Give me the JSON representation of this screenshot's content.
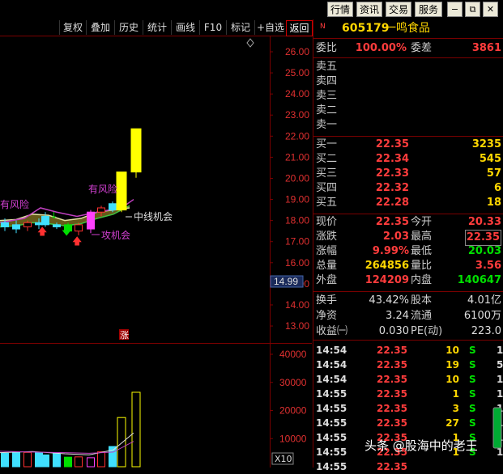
{
  "top_menu": [
    {
      "label": "行情"
    },
    {
      "label": "资讯"
    },
    {
      "label": "交易"
    },
    {
      "label": "服务"
    }
  ],
  "toolbar": [
    {
      "label": "复权"
    },
    {
      "label": "叠加"
    },
    {
      "label": "历史"
    },
    {
      "label": "统计"
    },
    {
      "label": "画线"
    },
    {
      "label": "F10"
    },
    {
      "label": "标记"
    },
    {
      "label": "+自选"
    },
    {
      "label": "返回"
    }
  ],
  "stock": {
    "marker": "N",
    "code": "605179",
    "name": "一鸣食品"
  },
  "weibi": {
    "label": "委比",
    "value": "100.00%",
    "label2": "委差",
    "value2": "3861"
  },
  "sell_levels": [
    {
      "label": "卖五"
    },
    {
      "label": "卖四"
    },
    {
      "label": "卖三"
    },
    {
      "label": "卖二"
    },
    {
      "label": "卖一"
    }
  ],
  "buy_levels": [
    {
      "label": "买一",
      "price": "22.35",
      "vol": "3235"
    },
    {
      "label": "买二",
      "price": "22.34",
      "vol": "545"
    },
    {
      "label": "买三",
      "price": "22.33",
      "vol": "57"
    },
    {
      "label": "买四",
      "price": "22.32",
      "vol": "6"
    },
    {
      "label": "买五",
      "price": "22.28",
      "vol": "18"
    }
  ],
  "stats": [
    {
      "l1": "现价",
      "v1": "22.35",
      "l2": "今开",
      "v2": "20.33"
    },
    {
      "l1": "涨跌",
      "v1": "2.03",
      "l2": "最高",
      "v2": "22.35"
    },
    {
      "l1": "涨幅",
      "v1": "9.99%",
      "l2": "最低",
      "v2": "20.03"
    },
    {
      "l1": "总量",
      "v1": "264856",
      "l2": "量比",
      "v2": "3.56"
    },
    {
      "l1": "外盘",
      "v1": "124209",
      "l2": "内盘",
      "v2": "140647"
    }
  ],
  "stats2": [
    {
      "l1": "换手",
      "v1": "43.42%",
      "l2": "股本",
      "v2": "4.01亿"
    },
    {
      "l1": "净资",
      "v1": "3.24",
      "l2": "流通",
      "v2": "6100万"
    },
    {
      "l1": "收益㈠",
      "v1": "0.030",
      "l2": "PE(动)",
      "v2": "223.0"
    }
  ],
  "ticks": [
    {
      "time": "14:54",
      "price": "22.35",
      "vol": "10",
      "side": "S",
      "n": "1"
    },
    {
      "time": "14:54",
      "price": "22.35",
      "vol": "19",
      "side": "S",
      "n": "5"
    },
    {
      "time": "14:54",
      "price": "22.35",
      "vol": "10",
      "side": "S",
      "n": "1"
    },
    {
      "time": "14:55",
      "price": "22.35",
      "vol": "1",
      "side": "S",
      "n": "1"
    },
    {
      "time": "14:55",
      "price": "22.35",
      "vol": "3",
      "side": "S",
      "n": "1"
    },
    {
      "time": "14:55",
      "price": "22.35",
      "vol": "27",
      "side": "S",
      "n": "1"
    },
    {
      "time": "14:55",
      "price": "22.35",
      "vol": "1",
      "side": "S",
      "n": "1"
    },
    {
      "time": "14:55",
      "price": "22.35",
      "vol": "1",
      "side": "S",
      "n": "1"
    },
    {
      "time": "14:55",
      "price": "22.35",
      "vol": "",
      "side": "",
      "n": ""
    }
  ],
  "chart": {
    "price_ticks": [
      "26.00",
      "25.00",
      "24.00",
      "23.00",
      "22.00",
      "21.00",
      "20.00",
      "19.00",
      "18.00",
      "17.00",
      "16.00",
      "15.00",
      "14.00",
      "13.00"
    ],
    "current_price_label": "14.99",
    "volume_ticks": [
      "40000",
      "30000",
      "20000",
      "10000"
    ],
    "volume_unit": "X10",
    "annotations": {
      "risk": "有风险",
      "risk2": "有风险",
      "mid": "中线机会",
      "attack": "攻机会",
      "zhang": "涨"
    }
  },
  "watermark": "头条 @股海中的老王",
  "colors": {
    "up": "#ff3c3c",
    "down": "#00e000",
    "yellow_candle": "#ffff00",
    "ma": "#c040c0"
  },
  "chart_data": {
    "type": "candlestick",
    "price_axis": {
      "ylim": [
        12.5,
        26.5
      ],
      "ticks": [
        26,
        25,
        24,
        23,
        22,
        21,
        20,
        19,
        18,
        17,
        16,
        15,
        14,
        13
      ]
    },
    "volume_axis": {
      "ylim": [
        0,
        45000
      ],
      "ticks": [
        40000,
        30000,
        20000,
        10000
      ],
      "unit": "X10"
    },
    "candles": [
      {
        "open": 17.9,
        "close": 17.7,
        "high": 18.1,
        "low": 17.5,
        "color": "cyan"
      },
      {
        "open": 17.8,
        "close": 17.6,
        "high": 18.0,
        "low": 17.4,
        "color": "cyan"
      },
      {
        "open": 17.7,
        "close": 17.9,
        "high": 18.0,
        "low": 17.5,
        "color": "red"
      },
      {
        "open": 17.9,
        "close": 17.8,
        "high": 18.1,
        "low": 17.6,
        "color": "cyan"
      },
      {
        "open": 17.8,
        "close": 18.2,
        "high": 18.4,
        "low": 17.7,
        "color": "cyan"
      },
      {
        "open": 17.8,
        "close": 17.7,
        "high": 17.9,
        "low": 17.6,
        "color": "cyan"
      },
      {
        "open": 17.8,
        "close": 17.5,
        "high": 17.9,
        "low": 17.4,
        "color": "green"
      },
      {
        "open": 17.5,
        "close": 17.8,
        "high": 17.9,
        "low": 17.3,
        "color": "red"
      },
      {
        "open": 17.6,
        "close": 18.4,
        "high": 18.5,
        "low": 17.4,
        "color": "magenta"
      },
      {
        "open": 18.4,
        "close": 18.6,
        "high": 18.7,
        "low": 18.2,
        "color": "red"
      },
      {
        "open": 18.5,
        "close": 18.8,
        "high": 18.9,
        "low": 18.4,
        "color": "cyan"
      },
      {
        "open": 18.5,
        "close": 20.3,
        "high": 20.3,
        "low": 18.4,
        "color": "yellow"
      },
      {
        "open": 20.3,
        "close": 22.35,
        "high": 22.35,
        "low": 20.03,
        "color": "yellow"
      }
    ],
    "volumes": [
      4800,
      5200,
      5100,
      5000,
      4200,
      4600,
      3400,
      3500,
      3200,
      5300,
      7200,
      17500,
      26485
    ]
  }
}
